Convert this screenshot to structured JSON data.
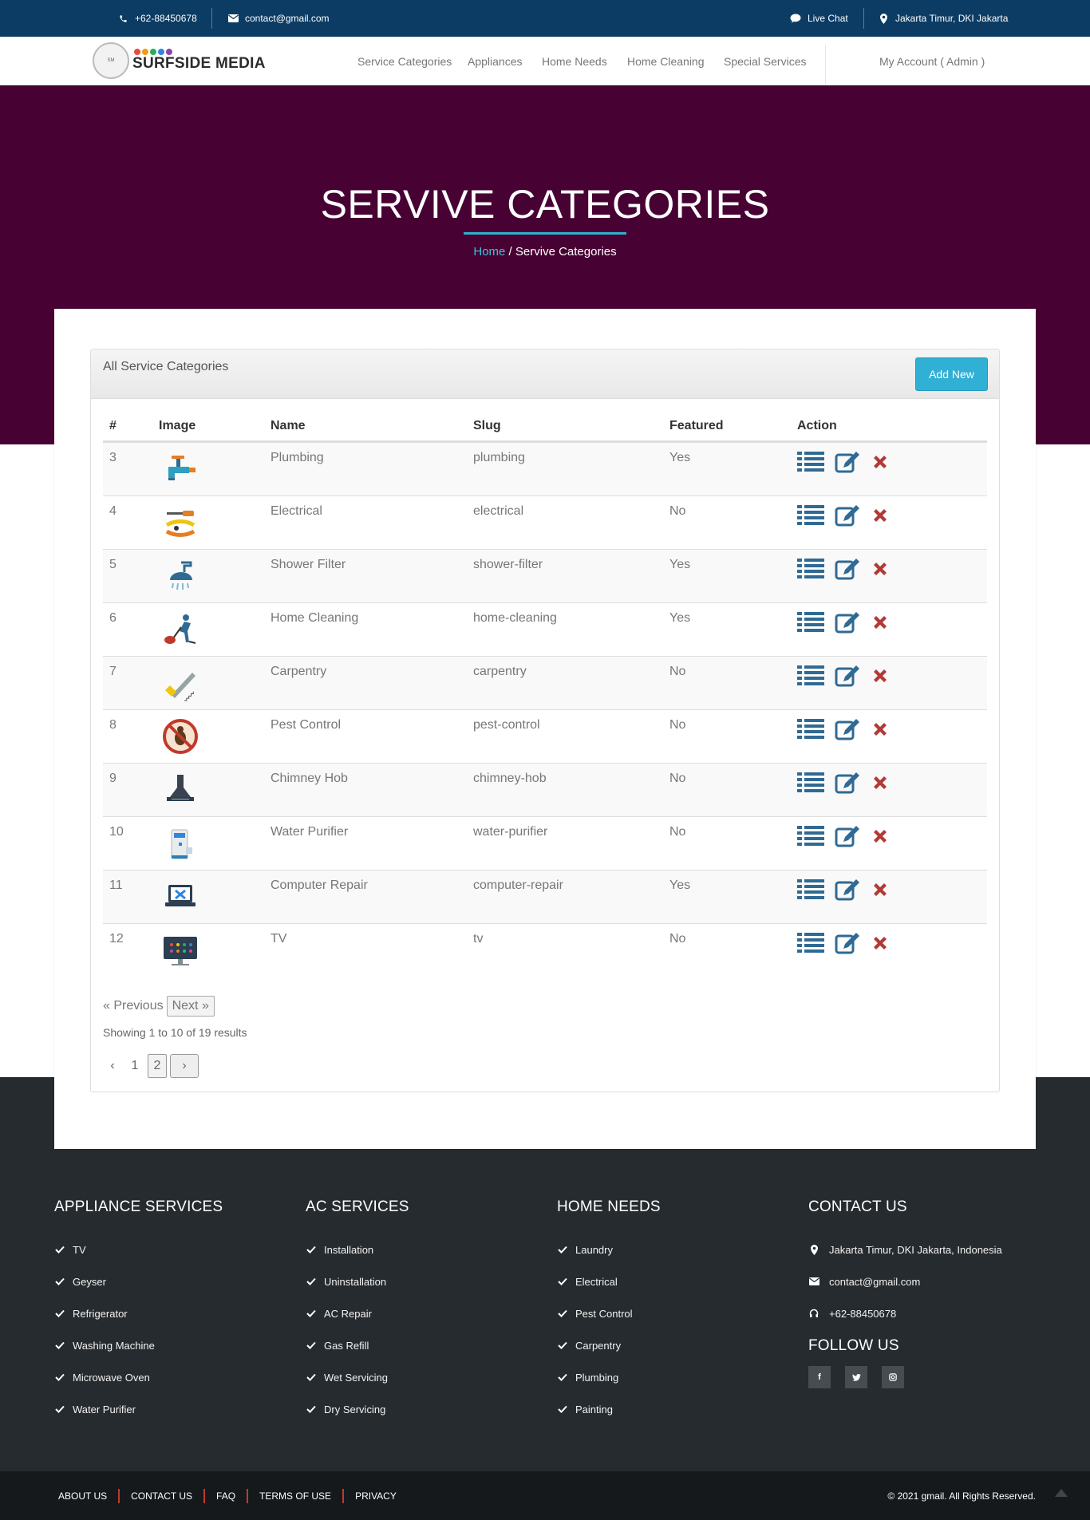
{
  "topbar": {
    "phone": "+62-88450678",
    "email": "contact@gmail.com",
    "live_chat": "Live Chat",
    "location": "Jakarta Timur, DKI Jakarta"
  },
  "nav": {
    "logo": "SURFSIDE MEDIA",
    "links": [
      "Service Categories",
      "Appliances",
      "Home Needs",
      "Home Cleaning",
      "Special Services"
    ],
    "account": "My Account ( Admin )"
  },
  "banner": {
    "title": "SERVIVE CATEGORIES",
    "crumb_home": "Home",
    "crumb_sep": "/",
    "crumb_current": "Servive Categories"
  },
  "panel": {
    "title": "All Service Categories",
    "add_button": "Add New"
  },
  "table": {
    "headers": [
      "#",
      "Image",
      "Name",
      "Slug",
      "Featured",
      "Action"
    ],
    "rows": [
      {
        "id": "3",
        "icon": "faucet-icon",
        "name": "Plumbing",
        "slug": "plumbing",
        "featured": "Yes"
      },
      {
        "id": "4",
        "icon": "screwdriver-pliers-icon",
        "name": "Electrical",
        "slug": "electrical",
        "featured": "No"
      },
      {
        "id": "5",
        "icon": "shower-icon",
        "name": "Shower Filter",
        "slug": "shower-filter",
        "featured": "Yes"
      },
      {
        "id": "6",
        "icon": "vacuum-cleaner-icon",
        "name": "Home Cleaning",
        "slug": "home-cleaning",
        "featured": "Yes"
      },
      {
        "id": "7",
        "icon": "saw-icon",
        "name": "Carpentry",
        "slug": "carpentry",
        "featured": "No"
      },
      {
        "id": "8",
        "icon": "no-bug-icon",
        "name": "Pest Control",
        "slug": "pest-control",
        "featured": "No"
      },
      {
        "id": "9",
        "icon": "chimney-hood-icon",
        "name": "Chimney Hob",
        "slug": "chimney-hob",
        "featured": "No"
      },
      {
        "id": "10",
        "icon": "water-purifier-icon",
        "name": "Water Purifier",
        "slug": "water-purifier",
        "featured": "No"
      },
      {
        "id": "11",
        "icon": "laptop-repair-icon",
        "name": "Computer Repair",
        "slug": "computer-repair",
        "featured": "Yes"
      },
      {
        "id": "12",
        "icon": "tv-icon",
        "name": "TV",
        "slug": "tv",
        "featured": "No"
      }
    ]
  },
  "pagination": {
    "previous": "« Previous",
    "next": "Next »",
    "showing": "Showing 1 to 10 of 19 results",
    "prev_arrow": "‹",
    "next_arrow": "›",
    "pages": [
      "1",
      "2"
    ]
  },
  "footer": {
    "appliance_title": "APPLIANCE SERVICES",
    "appliance_items": [
      "TV",
      "Geyser",
      "Refrigerator",
      "Washing Machine",
      "Microwave Oven",
      "Water Purifier"
    ],
    "ac_title": "AC SERVICES",
    "ac_items": [
      "Installation",
      "Uninstallation",
      "AC Repair",
      "Gas Refill",
      "Wet Servicing",
      "Dry Servicing"
    ],
    "home_title": "HOME NEEDS",
    "home_items": [
      "Laundry",
      "Electrical",
      "Pest Control",
      "Carpentry",
      "Plumbing",
      "Painting"
    ],
    "contact_title": "CONTACT US",
    "contact_address": "Jakarta Timur, DKI Jakarta, Indonesia",
    "contact_email": "contact@gmail.com",
    "contact_phone": "+62-88450678",
    "follow_title": "FOLLOW US",
    "social": [
      "facebook-icon",
      "twitter-icon",
      "instagram-icon"
    ]
  },
  "bottom": {
    "links": [
      "ABOUT US",
      "CONTACT US",
      "FAQ",
      "TERMS OF USE",
      "PRIVACY"
    ],
    "copyright": "© 2021 gmail. All Rights Reserved."
  },
  "colors": {
    "topbar": "#0c3c63",
    "banner": "#470233",
    "accent": "#2eb3c9",
    "button": "#31b0d5",
    "action_blue": "#2f6a94",
    "delete_red": "#b23a36",
    "footer": "#262b2f"
  }
}
